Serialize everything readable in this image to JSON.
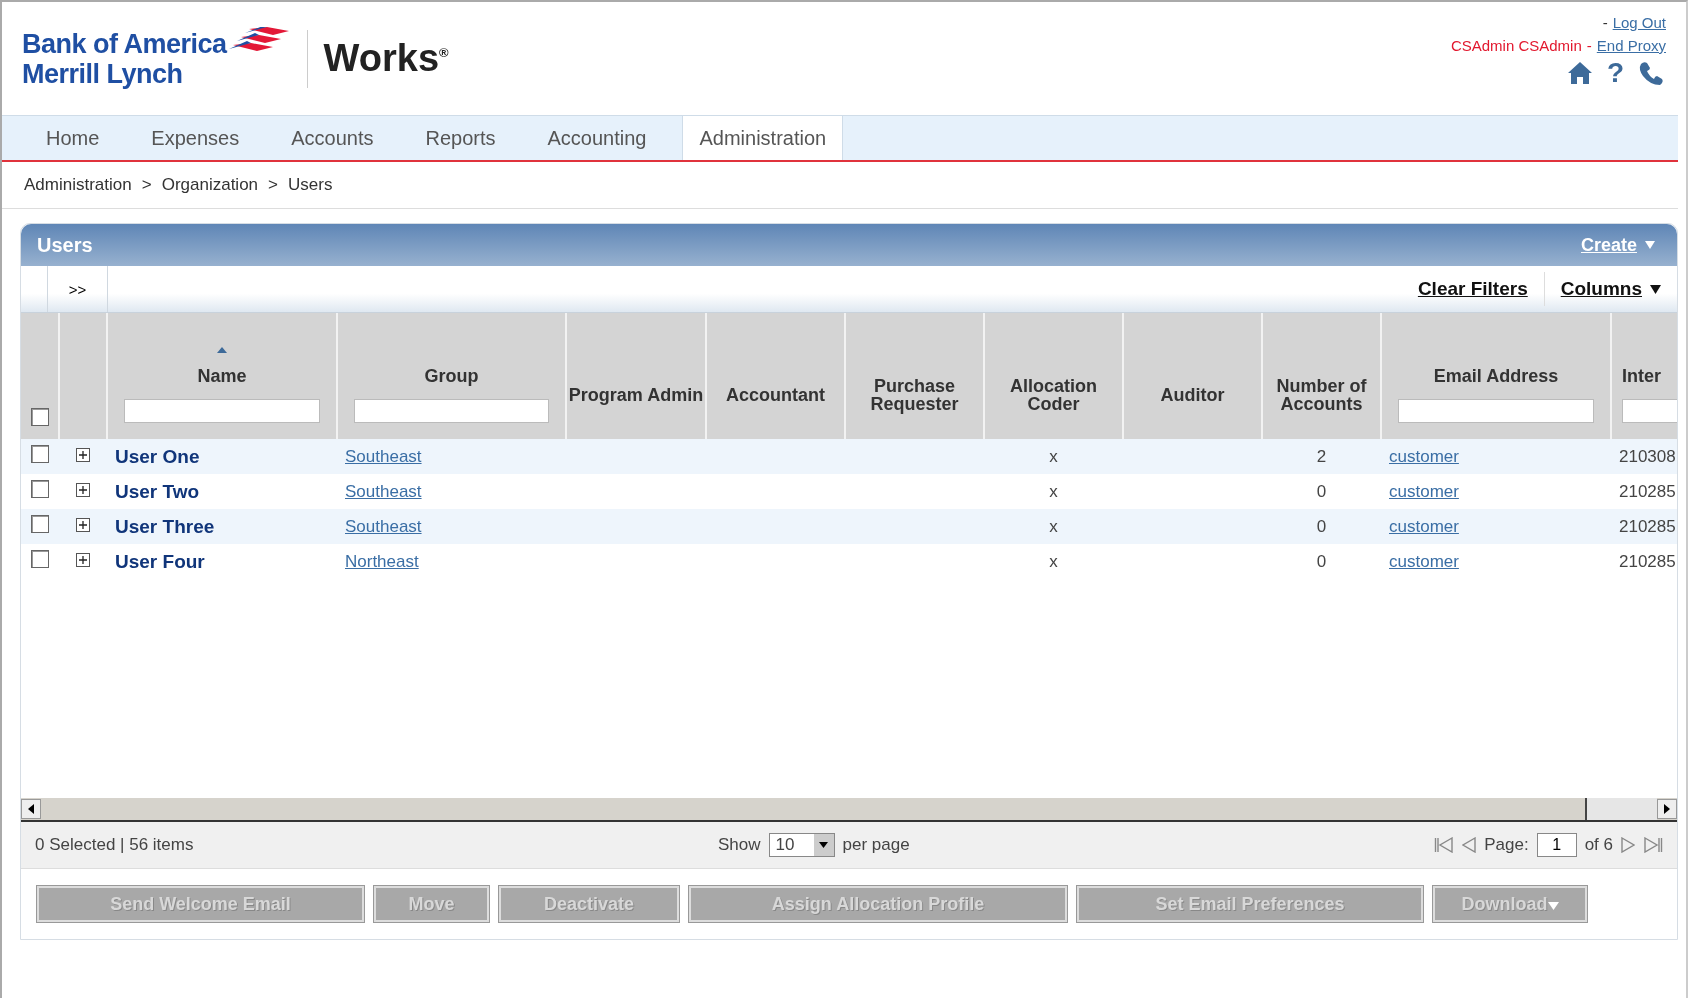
{
  "header": {
    "logo_line_1": "Bank of America",
    "logo_line_2": "Merrill Lynch",
    "product": "Works$^{®}$",
    "separator_1": "-",
    "logout": "Log Out",
    "user": "CSAdmin CSAdmin",
    "separator_2": "-",
    "end_proxy": "End Proxy",
    "help_icon": "?"
  },
  "tabs": [
    {
      "label": "Home",
      "selected": false
    },
    {
      "label": "Expenses",
      "selected": false
    },
    {
      "label": "Accounts",
      "selected": false
    },
    {
      "label": "Reports",
      "selected": false
    },
    {
      "label": "Accounting",
      "selected": false
    },
    {
      "label": "Administration",
      "selected": true
    }
  ],
  "breadcrumb": [
    {
      "label": "Administration",
      "separator": ">"
    },
    {
      "label": "Organization",
      "separator": ">"
    },
    {
      "label": "Users"
    }
  ],
  "panel": {
    "title": "Users",
    "create": "Create",
    "expand": ">>",
    "clear_filters": "Clear Filters",
    "columns_menu": "Columns"
  },
  "table": {
    "select_all_checked": false,
    "columns": [
      {
        "label": "Name",
        "kind": "bold",
        "filter": true,
        "sorted": true
      },
      {
        "label": "Group",
        "kind": "link",
        "filter": true,
        "sorted": false
      },
      {
        "label": "Program Admin",
        "kind": "mark",
        "filter": false,
        "sorted": false
      },
      {
        "label": "Accountant",
        "kind": "mark",
        "filter": false,
        "sorted": false
      },
      {
        "label": "Purchase Requester",
        "kind": "mark",
        "filter": false,
        "sorted": false
      },
      {
        "label": "Allocation Coder",
        "kind": "mark",
        "filter": false,
        "sorted": false
      },
      {
        "label": "Auditor",
        "kind": "mark",
        "filter": false,
        "sorted": false
      },
      {
        "label": "Number of Accounts",
        "kind": "number",
        "filter": false,
        "sorted": false
      },
      {
        "label": "Email Address",
        "kind": "link",
        "filter": true,
        "sorted": false
      },
      {
        "label": "Inter",
        "kind": "text",
        "filter": true,
        "sorted": false
      }
    ],
    "rows": [
      {
        "checked": false,
        "cells": [
          "User One",
          "Southeast",
          null,
          null,
          null,
          "x",
          null,
          "2",
          "customer",
          "210308"
        ]
      },
      {
        "checked": false,
        "cells": [
          "User Two",
          "Southeast",
          null,
          null,
          null,
          "x",
          null,
          "0",
          "customer",
          "210285"
        ]
      },
      {
        "checked": false,
        "cells": [
          "User Three",
          "Southeast",
          null,
          null,
          null,
          "x",
          null,
          "0",
          "customer",
          "210285"
        ]
      },
      {
        "checked": false,
        "cells": [
          "User Four",
          "Northeast",
          null,
          null,
          null,
          "x",
          null,
          "0",
          "customer",
          "210285"
        ]
      }
    ]
  },
  "footer": {
    "summary": "0 Selected | 56 items",
    "show": "Show",
    "per_page_value": "10",
    "per_page": "per page",
    "page_label": "Page:",
    "page_value": "1",
    "page_of": "of 6"
  },
  "buttons": [
    {
      "label": "Send Welcome Email",
      "disabled": true,
      "menu": false
    },
    {
      "label": "Move",
      "disabled": true,
      "menu": false
    },
    {
      "label": "Deactivate",
      "disabled": true,
      "menu": false
    },
    {
      "label": "Assign Allocation Profile",
      "disabled": true,
      "menu": false
    },
    {
      "label": "Set Email Preferences",
      "disabled": true,
      "menu": false
    },
    {
      "label": "Download",
      "disabled": true,
      "menu": true
    }
  ]
}
